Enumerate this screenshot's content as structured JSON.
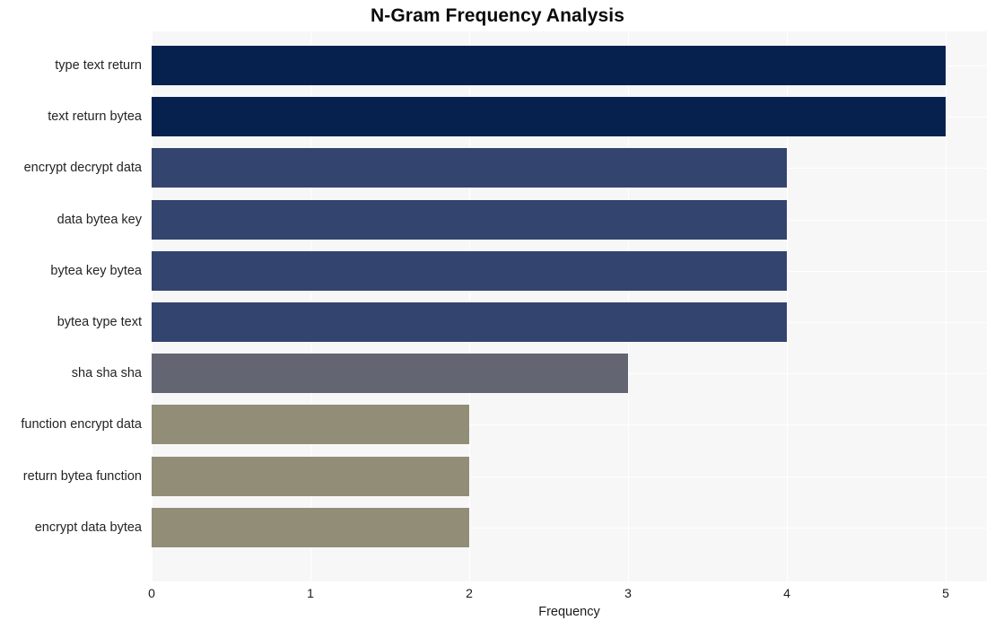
{
  "chart_data": {
    "type": "bar",
    "orientation": "horizontal",
    "title": "N-Gram Frequency Analysis",
    "xlabel": "Frequency",
    "ylabel": "",
    "xlim": [
      0,
      5.26
    ],
    "xticks": [
      0,
      1,
      2,
      3,
      4,
      5
    ],
    "xtick_labels": [
      "0",
      "1",
      "2",
      "3",
      "4",
      "5"
    ],
    "grid": true,
    "legend": false,
    "categories": [
      "type text return",
      "text return bytea",
      "encrypt decrypt data",
      "data bytea key",
      "bytea key bytea",
      "bytea type text",
      "sha sha sha",
      "function encrypt data",
      "return bytea function",
      "encrypt data bytea"
    ],
    "values": [
      5,
      5,
      4,
      4,
      4,
      4,
      3,
      2,
      2,
      2
    ],
    "bar_colors": [
      "#06214d",
      "#06214d",
      "#33446e",
      "#33446e",
      "#33446e",
      "#33446e",
      "#636672",
      "#928d76",
      "#928d76",
      "#928d76"
    ],
    "plot_background": "#f7f7f8",
    "gridline_color": "#ffffff",
    "figure_background": "#ffffff",
    "title_color": "#0b0b0b"
  }
}
